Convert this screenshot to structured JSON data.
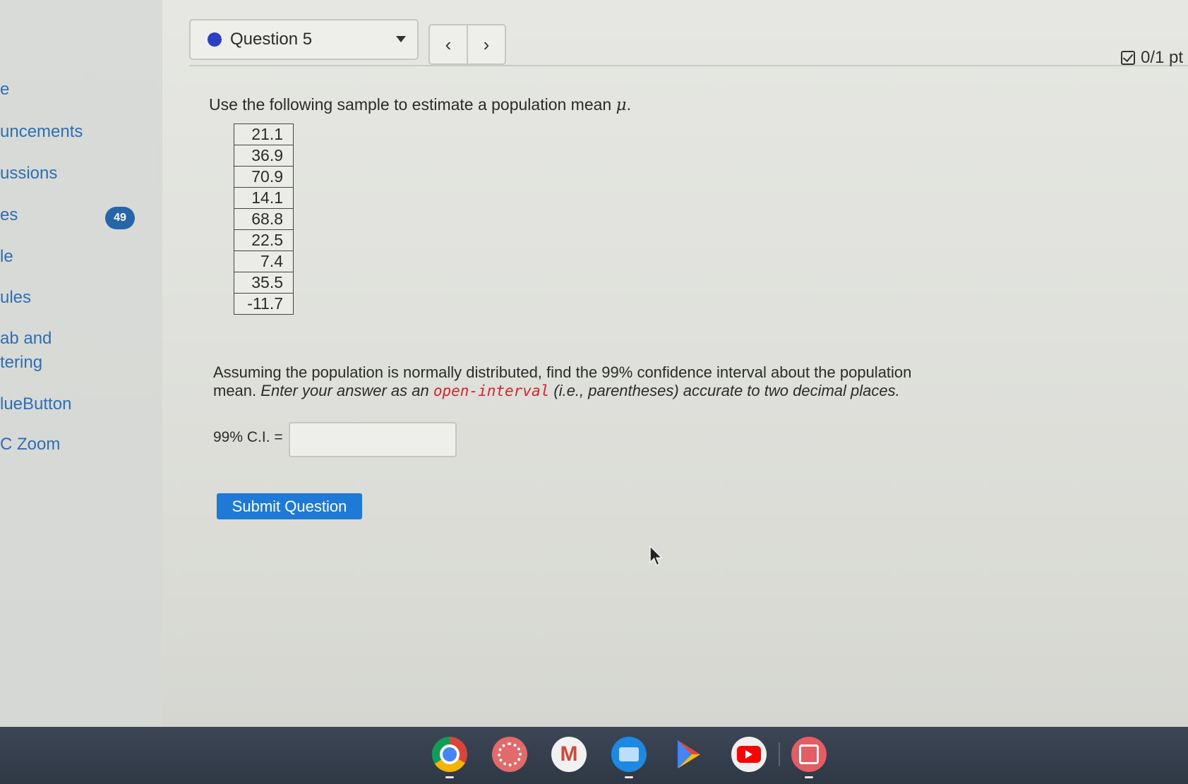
{
  "sidebar": {
    "items": [
      {
        "label": "e"
      },
      {
        "label": "uncements"
      },
      {
        "label": "ussions"
      },
      {
        "label": "es"
      },
      {
        "label": "le"
      },
      {
        "label": "ules"
      },
      {
        "label": "ab and"
      },
      {
        "label": "tering"
      },
      {
        "label": "lueButton"
      },
      {
        "label": "C Zoom"
      }
    ],
    "badge": "49"
  },
  "question_nav": {
    "selected": "Question 5",
    "prev_symbol": "‹",
    "next_symbol": "›",
    "points": "0/1 pt"
  },
  "question": {
    "prompt_text": "Use the following sample to estimate a population mean ",
    "mu_symbol": "μ",
    "prompt_end": ".",
    "sample": [
      "21.1",
      "36.9",
      "70.9",
      "14.1",
      "68.8",
      "22.5",
      "7.4",
      "35.5",
      "-11.7"
    ],
    "instr_line1": "Assuming the population is normally distributed, find the 99% confidence interval about the population",
    "instr_mean": "mean.",
    "instr_italic_a": "Enter your answer as an",
    "instr_highlight": "open-interval",
    "instr_italic_b": "(i.e., parentheses) accurate to two decimal places.",
    "ci_label": "99% C.I. =",
    "ci_value": "",
    "submit_label": "Submit Question"
  },
  "colors": {
    "link_blue": "#2d6fb5",
    "submit_blue": "#1f79d6",
    "highlight_red": "#d2262d",
    "badge_blue": "#2565a8",
    "question_dot": "#2a3fc4"
  },
  "shelf": {
    "apps": [
      {
        "name": "chrome-icon",
        "color": "#db4437"
      },
      {
        "name": "canvas-icon",
        "color": "#e36a6a"
      },
      {
        "name": "gmail-icon",
        "color": "#f1f1f1"
      },
      {
        "name": "files-icon",
        "color": "#1e88e5"
      },
      {
        "name": "play-store-icon",
        "color": "#3c4655"
      },
      {
        "name": "youtube-icon",
        "color": "#f0f0f0"
      },
      {
        "name": "app-icon",
        "color": "#e35d62"
      }
    ]
  }
}
